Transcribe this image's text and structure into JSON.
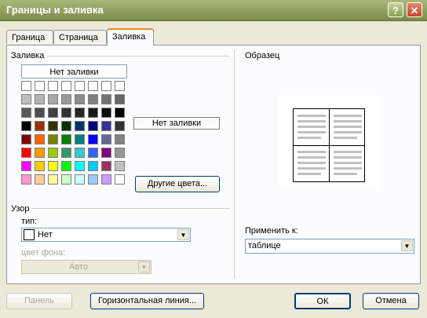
{
  "window": {
    "title": "Границы и заливка",
    "help_label": "?",
    "close_label": "✕"
  },
  "tabs": [
    {
      "label": "Граница"
    },
    {
      "label": "Страница"
    },
    {
      "label": "Заливка"
    }
  ],
  "fill": {
    "group_label": "Заливка",
    "none_label": "Нет заливки",
    "selected_label": "Нет заливки",
    "more_colors_label": "Другие цвета..."
  },
  "pattern": {
    "group_label": "Узор",
    "type_label": "тип:",
    "type_value": "Нет",
    "bg_label": "цвет фона:",
    "bg_value": "Авто"
  },
  "sample": {
    "group_label": "Образец"
  },
  "apply": {
    "label": "Применить к:",
    "value": "таблице"
  },
  "footer": {
    "panel_label": "Панель",
    "hline_label": "Горизонтальная линия...",
    "ok_label": "ОК",
    "cancel_label": "Отмена"
  },
  "palette": [
    [
      "#ffffff",
      "#ffffff",
      "#ffffff",
      "#ffffff",
      "#ffffff",
      "#ffffff",
      "#ffffff",
      "#ffffff"
    ],
    [
      "#bfbfbf",
      "#b3b3b3",
      "#a6a6a6",
      "#999999",
      "#8c8c8c",
      "#808080",
      "#737373",
      "#666666"
    ],
    [
      "#595959",
      "#4d4d4d",
      "#404040",
      "#333333",
      "#262626",
      "#1a1a1a",
      "#0d0d0d",
      "#000000"
    ],
    [
      "#000000",
      "#993300",
      "#333300",
      "#003300",
      "#003366",
      "#000080",
      "#333399",
      "#333333"
    ],
    [
      "#800000",
      "#ff6600",
      "#808000",
      "#008000",
      "#008080",
      "#0000ff",
      "#666699",
      "#808080"
    ],
    [
      "#ff0000",
      "#ff9900",
      "#99cc00",
      "#339966",
      "#33cccc",
      "#3366ff",
      "#800080",
      "#969696"
    ],
    [
      "#ff00ff",
      "#ffcc00",
      "#ffff00",
      "#00ff00",
      "#00ffff",
      "#00ccff",
      "#993366",
      "#c0c0c0"
    ],
    [
      "#ff99cc",
      "#ffcc99",
      "#ffff99",
      "#ccffcc",
      "#ccffff",
      "#99ccff",
      "#cc99ff",
      "#ffffff"
    ]
  ]
}
